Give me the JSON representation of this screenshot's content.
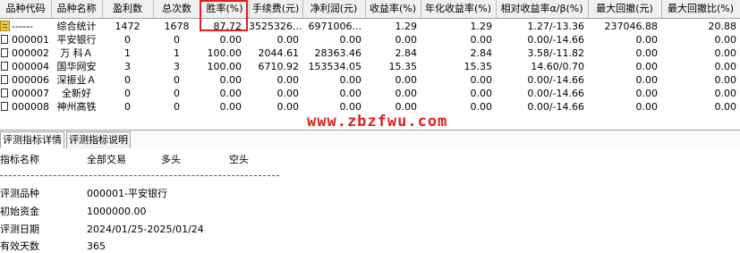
{
  "table": {
    "headers": [
      "品种代码",
      "品种名称",
      "盈利数",
      "总次数",
      "胜率(%)",
      "手续费(元)",
      "净利润(元)",
      "收益率(%)",
      "年化收益率(%)",
      "相对收益率α/β(%)",
      "最大回撤(元)",
      "最大回撤比(%)"
    ],
    "rows": [
      {
        "code": "------",
        "name": "综合统计",
        "profit_count": "1472",
        "total": "1678",
        "win_rate": "87.72",
        "fee": "3525326...",
        "net": "6971006...",
        "return": "1.29",
        "annual": "1.29",
        "relative": "1.27/-13.36",
        "max_dd": "237046.88",
        "max_dd_pct": "20.88",
        "icon": "summary-icon"
      },
      {
        "code": "000001",
        "name": "平安银行",
        "profit_count": "0",
        "total": "0",
        "win_rate": "0.00",
        "fee": "0.00",
        "net": "0.00",
        "return": "0.00",
        "annual": "0.00",
        "relative": "0.00/-14.66",
        "max_dd": "0.00",
        "max_dd_pct": "0.00",
        "icon": "document-icon"
      },
      {
        "code": "000002",
        "name": "万 科Ａ",
        "profit_count": "1",
        "total": "1",
        "win_rate": "100.00",
        "fee": "2044.61",
        "net": "28363.46",
        "return": "2.84",
        "annual": "2.84",
        "relative": "3.58/-11.82",
        "max_dd": "0.00",
        "max_dd_pct": "0.00",
        "icon": "document-icon"
      },
      {
        "code": "000004",
        "name": "国华网安",
        "profit_count": "3",
        "total": "3",
        "win_rate": "100.00",
        "fee": "6710.92",
        "net": "153534.05",
        "return": "15.35",
        "annual": "15.35",
        "relative": "14.60/0.70",
        "max_dd": "0.00",
        "max_dd_pct": "0.00",
        "icon": "document-icon"
      },
      {
        "code": "000006",
        "name": "深振业Ａ",
        "profit_count": "0",
        "total": "0",
        "win_rate": "0.00",
        "fee": "0.00",
        "net": "0.00",
        "return": "0.00",
        "annual": "0.00",
        "relative": "0.00/-14.66",
        "max_dd": "0.00",
        "max_dd_pct": "0.00",
        "icon": "document-icon"
      },
      {
        "code": "000007",
        "name": "全新好",
        "profit_count": "0",
        "total": "0",
        "win_rate": "0.00",
        "fee": "0.00",
        "net": "0.00",
        "return": "0.00",
        "annual": "0.00",
        "relative": "0.00/-14.66",
        "max_dd": "0.00",
        "max_dd_pct": "0.00",
        "icon": "document-icon"
      },
      {
        "code": "000008",
        "name": "神州高铁",
        "profit_count": "0",
        "total": "0",
        "win_rate": "0.00",
        "fee": "0.00",
        "net": "0.00",
        "return": "0.00",
        "annual": "0.00",
        "relative": "0.00/-14.66",
        "max_dd": "0.00",
        "max_dd_pct": "0.00",
        "icon": "document-icon"
      }
    ]
  },
  "watermark": "www.zbzfwu.com",
  "tabs": [
    "评测指标详情",
    "评测指标说明"
  ],
  "detail": {
    "headers": [
      "指标名称",
      "全部交易",
      "多头",
      "空头"
    ],
    "items": [
      {
        "label": "评测品种",
        "value": "000001-平安银行"
      },
      {
        "label": "初始资金",
        "value": "1000000.00"
      },
      {
        "label": "评测日期",
        "value": "2024/01/25-2025/01/24"
      },
      {
        "label": "有效天数",
        "value": "365"
      }
    ]
  },
  "colors": {
    "highlight": "#e0201c",
    "header_bg": "#f0f0f0"
  }
}
